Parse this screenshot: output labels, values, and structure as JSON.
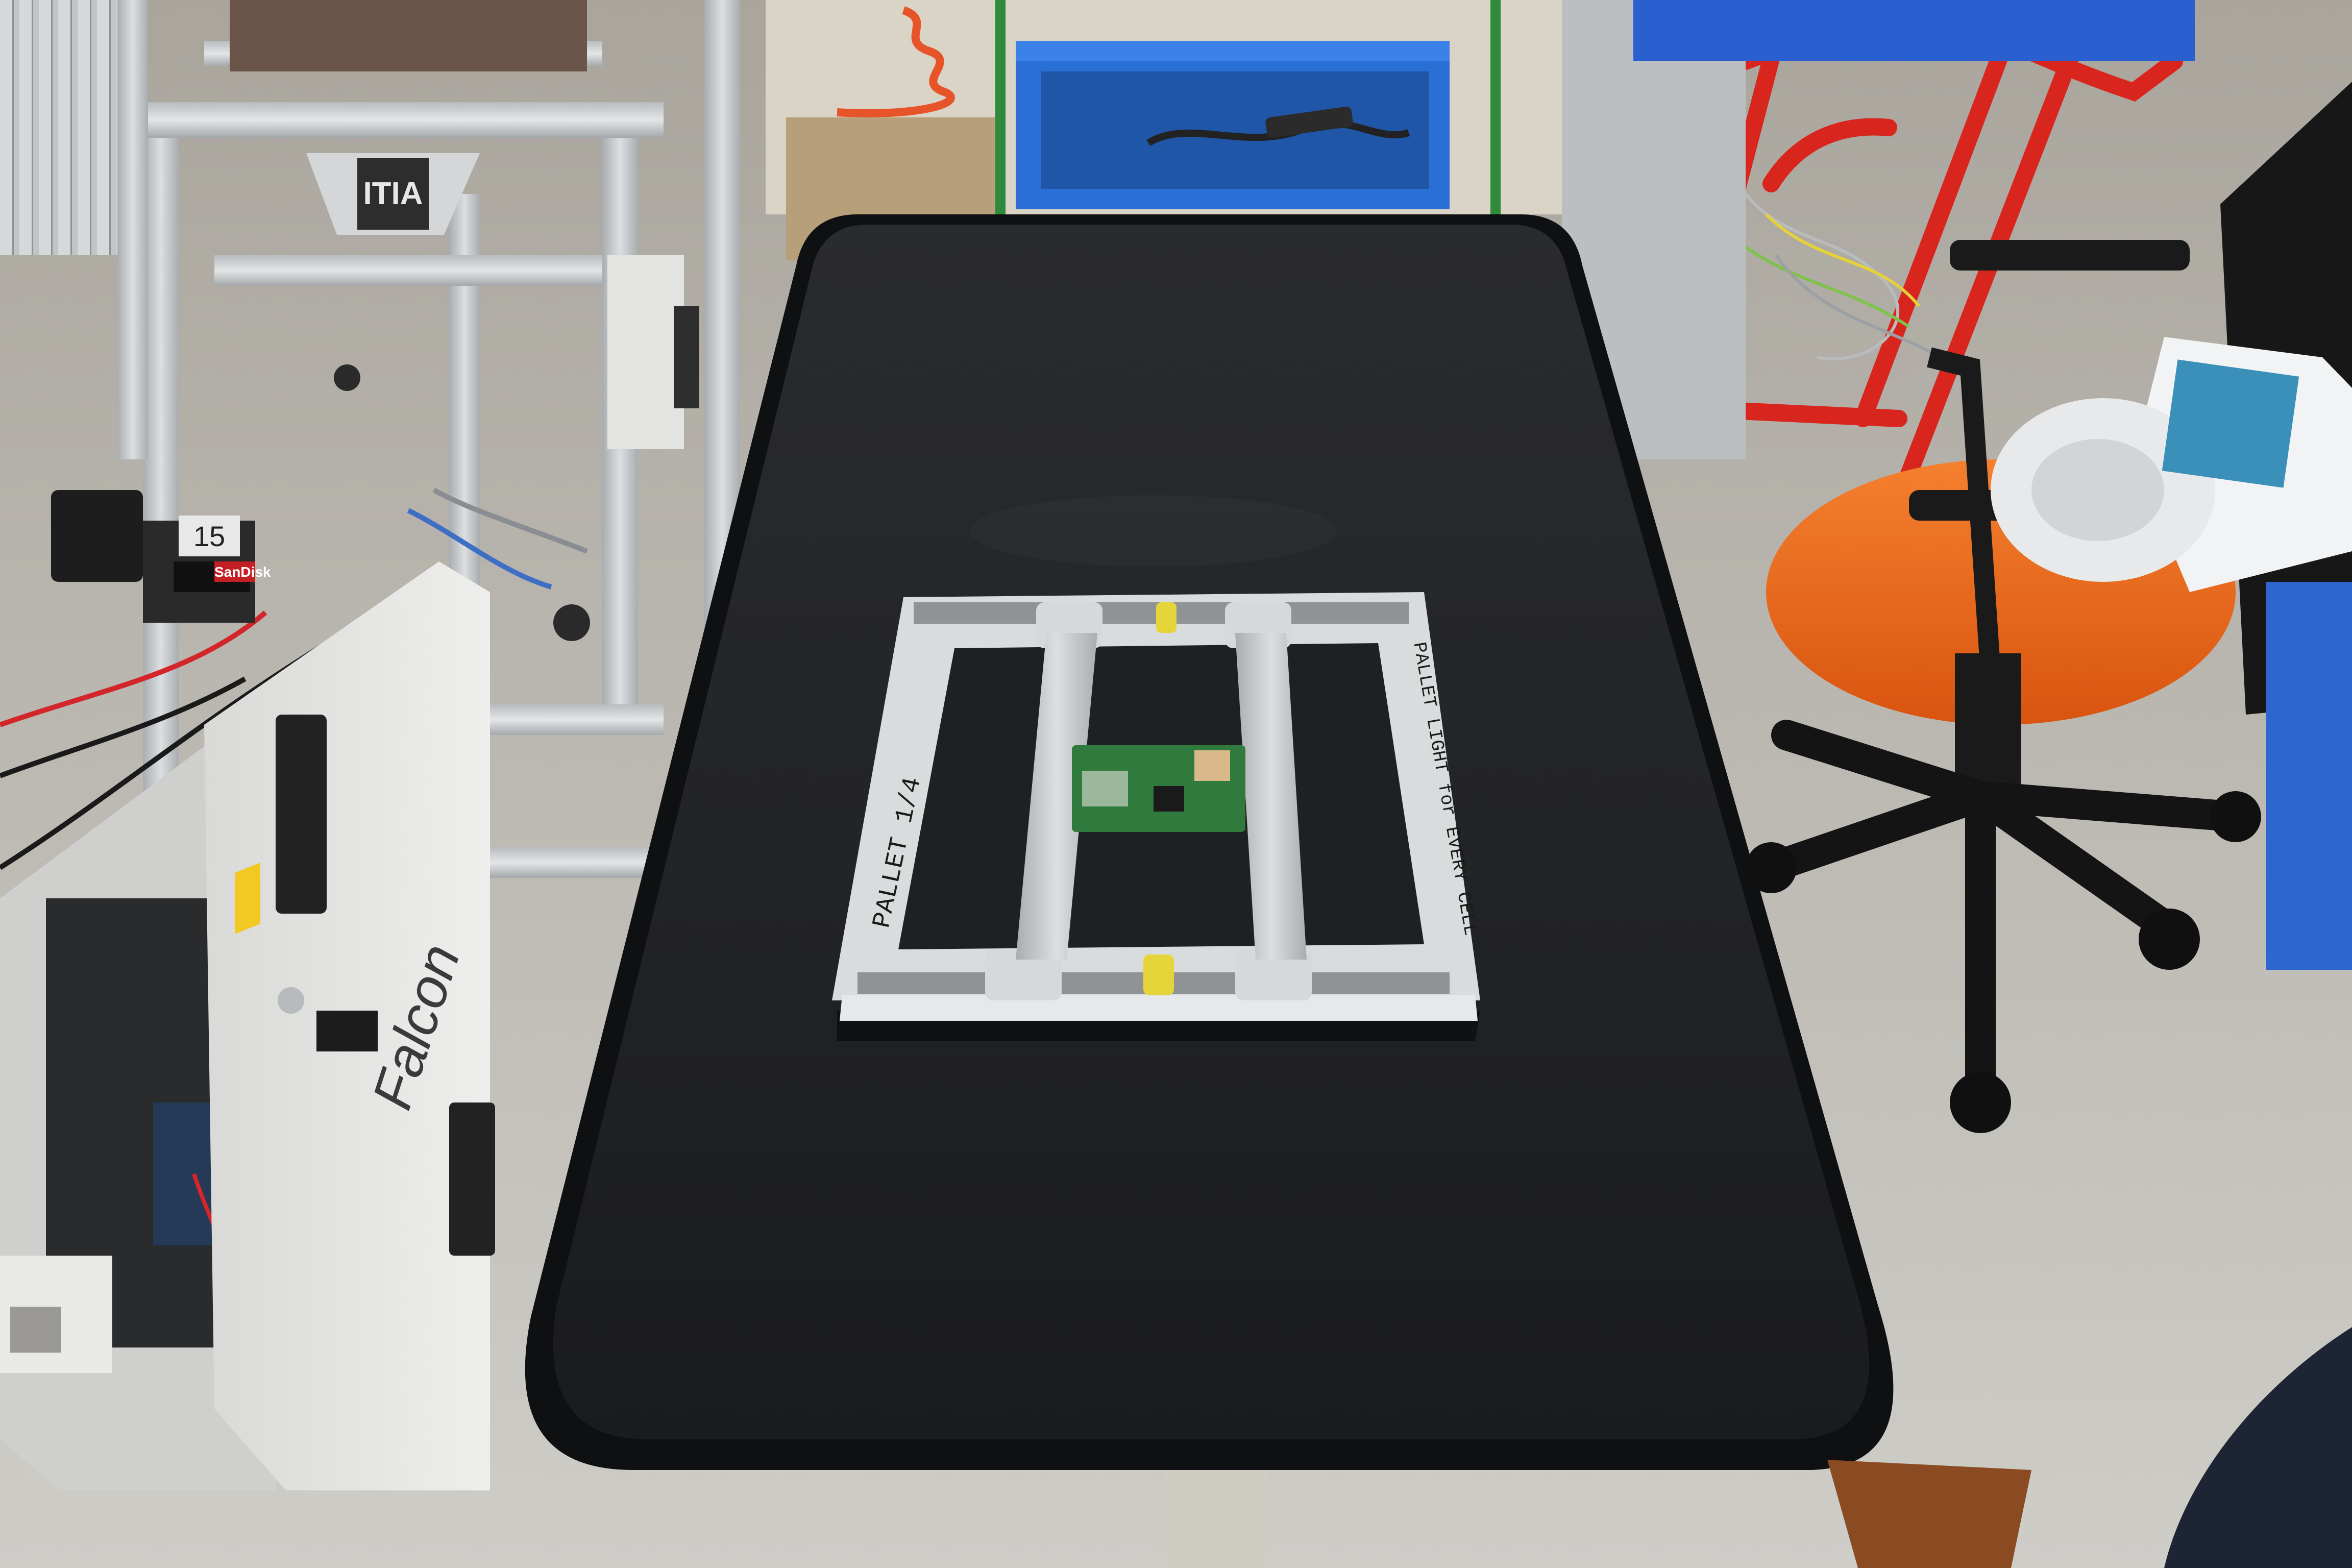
{
  "photo": {
    "subject": "workcell",
    "colors": {
      "floor": "#c4c2bc",
      "table_top": "#1e1f21",
      "table_edge": "#0d0e10",
      "aluminium": "#c9ccce",
      "pcb": "#2f7a3c",
      "chair_seat": "#f06a1c",
      "hand_truck": "#d8261e",
      "blue_bin": "#2a6fd6"
    }
  },
  "labels": {
    "cabinet_brand": "Falcon",
    "frame_sign": "ITIA",
    "sd_card_brand": "SanDisk",
    "cabinet_number": "15",
    "pallet_marking_left": "PALLET 1/4",
    "pallet_marking_right": "PALLET LIGHT for EVERY CELL"
  }
}
